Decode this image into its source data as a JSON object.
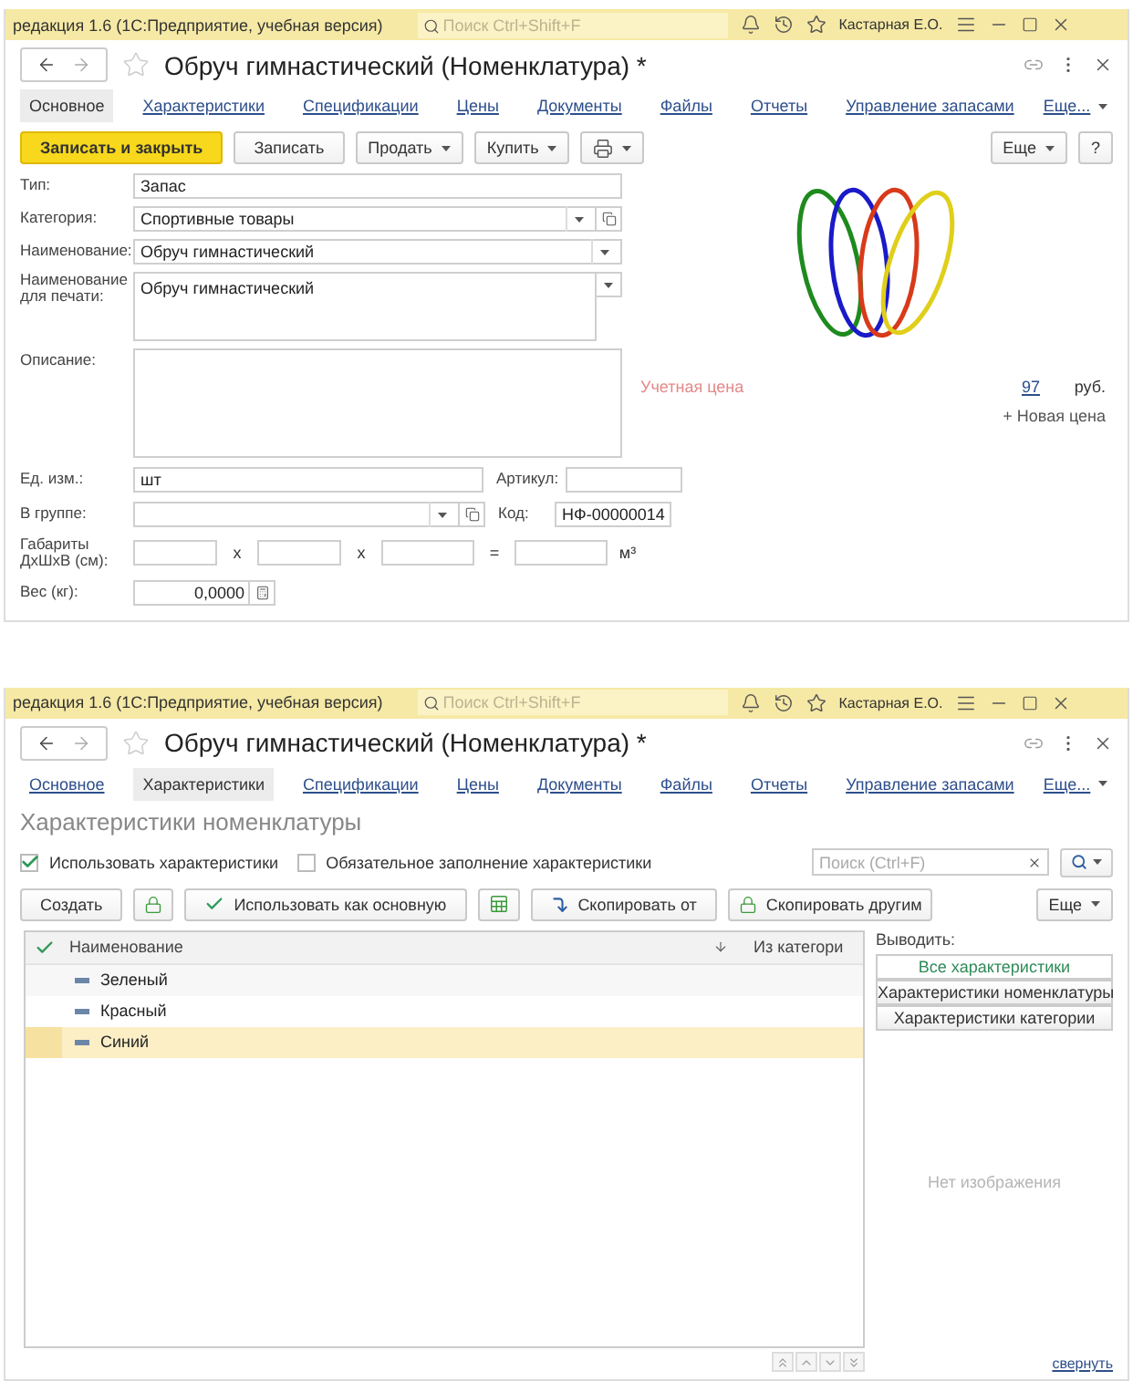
{
  "item_window": {
    "title_bar": {
      "app_title": "редакция 1.6  (1С:Предприятие, учебная версия)",
      "search_placeholder": "Поиск Ctrl+Shift+F",
      "user": "Кастарная Е.О."
    },
    "form_title": "Обруч гимнастический (Номенклатура) *",
    "tabs": [
      {
        "label": "Основное",
        "selected": true
      },
      {
        "label": "Характеристики",
        "selected": false
      },
      {
        "label": "Спецификации",
        "selected": false
      },
      {
        "label": "Цены",
        "selected": false
      },
      {
        "label": "Документы",
        "selected": false
      },
      {
        "label": "Файлы",
        "selected": false
      },
      {
        "label": "Отчеты",
        "selected": false
      },
      {
        "label": "Управление запасами",
        "selected": false
      }
    ],
    "tabs_more": "Еще...",
    "toolbar": [
      {
        "kind": "primary",
        "label": "Записать и закрыть"
      },
      {
        "kind": "plain",
        "label": "Записать"
      },
      {
        "kind": "menu",
        "label": "Продать"
      },
      {
        "kind": "menu",
        "label": "Купить"
      },
      {
        "kind": "print"
      }
    ],
    "more": "Еще",
    "help": "?",
    "fields": [
      {
        "kind": "text",
        "label": "Тип:",
        "value": "Запас"
      },
      {
        "kind": "select_open",
        "label": "Категория:",
        "value": "Спортивные товары"
      },
      {
        "kind": "select",
        "label": "Наименование:",
        "value": "Обруч гимнастический"
      },
      {
        "kind": "multiline_select",
        "label": "Наименование для печати:",
        "value": "Обруч гимнастический"
      },
      {
        "kind": "textarea",
        "label": "Описание:"
      }
    ],
    "price": {
      "label": "Учетная цена",
      "value": "97",
      "currency": "руб.",
      "new_price": "+ Новая цена"
    },
    "unit": {
      "label": "Ед. изм.:",
      "value": "шт"
    },
    "article": {
      "label": "Артикул:"
    },
    "group": {
      "label": "В группе:"
    },
    "code": {
      "label": "Код:",
      "value": "НФ-00000014"
    },
    "dimensions": {
      "label": "Габариты ДхШхВ (см):",
      "sep_1": "х",
      "sep_2": "х",
      "equals": "=",
      "unit": "м³"
    },
    "weight": {
      "label": "Вес (кг):",
      "value": "0,0000"
    }
  },
  "characteristics_window": {
    "title_bar": {
      "app_title": "редакция 1.6  (1С:Предприятие, учебная версия)",
      "search_placeholder": "Поиск Ctrl+Shift+F",
      "user": "Кастарная Е.О."
    },
    "form_title": "Обруч гимнастический (Номенклатура) *",
    "tabs": [
      {
        "label": "Основное",
        "selected": false
      },
      {
        "label": "Характеристики",
        "selected": true
      },
      {
        "label": "Спецификации",
        "selected": false
      },
      {
        "label": "Цены",
        "selected": false
      },
      {
        "label": "Документы",
        "selected": false
      },
      {
        "label": "Файлы",
        "selected": false
      },
      {
        "label": "Отчеты",
        "selected": false
      },
      {
        "label": "Управление запасами",
        "selected": false
      }
    ],
    "tabs_more": "Еще...",
    "heading": "Характеристики номенклатуры",
    "options": [
      {
        "label": "Использовать характеристики",
        "checked": true
      },
      {
        "label": "Обязательное заполнение характеристики",
        "checked": false
      }
    ],
    "search_placeholder": "Поиск (Ctrl+F)",
    "toolbar": [
      {
        "kind": "plain",
        "label": "Создать"
      },
      {
        "kind": "lock"
      },
      {
        "kind": "check",
        "label": "Использовать как основную"
      },
      {
        "kind": "sheet"
      },
      {
        "kind": "copy_from",
        "label": "Скопировать от"
      },
      {
        "kind": "lock",
        "label": "Скопировать другим"
      }
    ],
    "more": "Еще",
    "table": {
      "columns": [
        "Наименование",
        "Из категори"
      ],
      "rows": [
        {
          "name": "Зеленый",
          "selected": false
        },
        {
          "name": "Красный",
          "selected": false
        },
        {
          "name": "Синий",
          "selected": true
        }
      ]
    },
    "filter": {
      "label": "Выводить:",
      "options": [
        {
          "label": "Все характеристики",
          "selected": true
        },
        {
          "label": "Характеристики номенклатуры",
          "selected": false
        },
        {
          "label": "Характеристики категории",
          "selected": false
        }
      ]
    },
    "image_placeholder": "Нет изображения",
    "collapse": "свернуть"
  }
}
